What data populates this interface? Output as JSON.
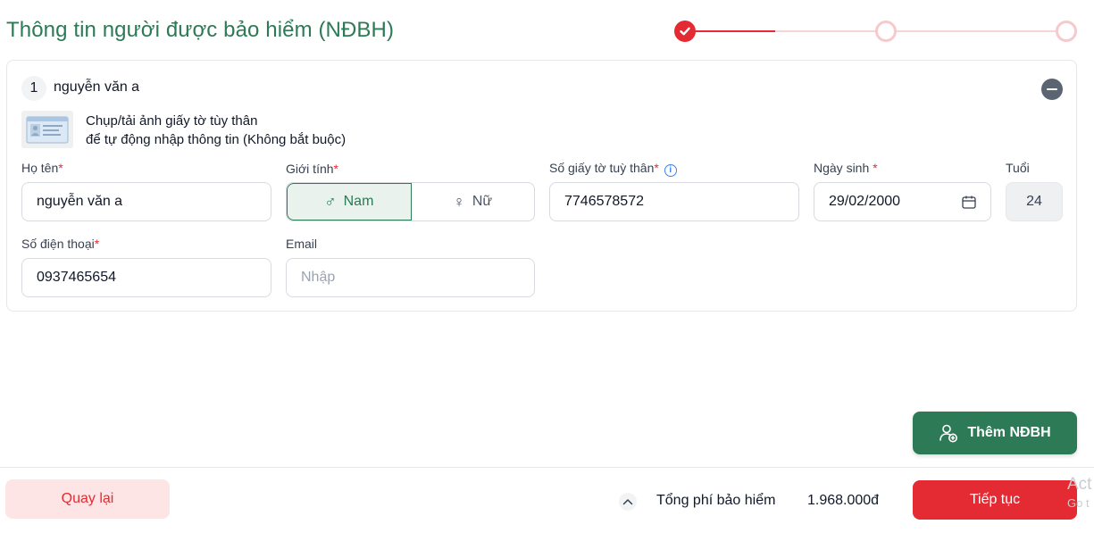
{
  "page": {
    "title": "Thông tin người được bảo hiểm (NĐBH)"
  },
  "stepper": {
    "steps": [
      "done",
      "pending",
      "pending"
    ]
  },
  "person": {
    "index": "1",
    "name": "nguyễn văn a"
  },
  "id_upload": {
    "line1": "Chụp/tải ảnh giấy tờ tùy thân",
    "line2": "để tự động nhập thông tin (Không bắt buộc)"
  },
  "form": {
    "full_name": {
      "label": "Họ tên",
      "required": "*",
      "value": "nguyễn văn a"
    },
    "gender": {
      "label": "Giới tính",
      "required": "*",
      "options": [
        {
          "label": "Nam",
          "symbol": "♂",
          "selected": true
        },
        {
          "label": "Nữ",
          "symbol": "♀",
          "selected": false
        }
      ]
    },
    "id_number": {
      "label": "Số giấy tờ tuỳ thân",
      "required": "*",
      "info": "i",
      "value": "7746578572"
    },
    "birth_date": {
      "label": "Ngày sinh",
      "required": "*",
      "value": "29/02/2000"
    },
    "age": {
      "label": "Tuổi",
      "value": "24"
    },
    "phone": {
      "label": "Số điện thoại",
      "required": "*",
      "value": "0937465654"
    },
    "email": {
      "label": "Email",
      "placeholder": "Nhập",
      "value": ""
    }
  },
  "actions": {
    "add_insured": "Thêm NĐBH",
    "back": "Quay lại",
    "next": "Tiếp tục"
  },
  "footer": {
    "total_label": "Tổng phí bảo hiểm",
    "total_value": "1.968.000đ"
  },
  "watermark": {
    "line1": "Act",
    "line2": "Go t"
  },
  "colors": {
    "brand_green": "#2c7a56",
    "brand_red": "#e42a32"
  }
}
